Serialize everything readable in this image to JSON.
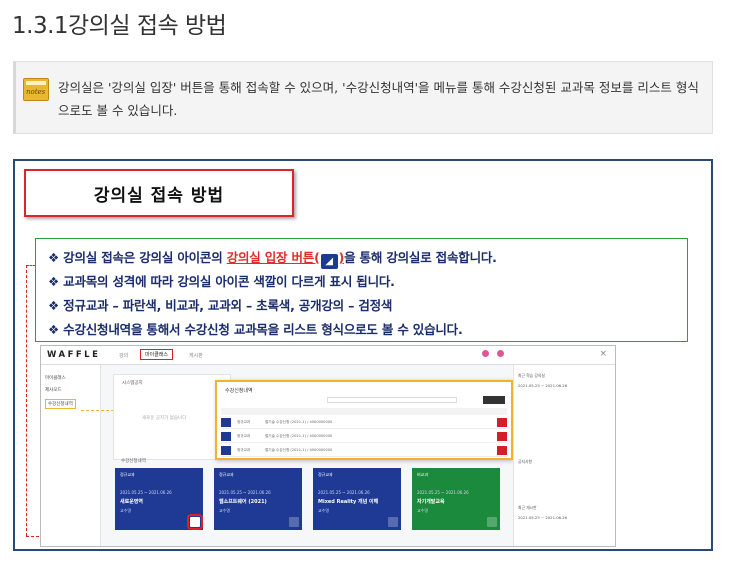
{
  "heading": "1.3.1강의실 접속 방법",
  "note": {
    "icon_label": "notes",
    "text": "강의실은 '강의실 입장' 버튼을 통해 접속할 수 있으며, '수강신청내역'을 메뉴를 통해 수강신청된 교과목 정보를 리스트 형식으로도 볼 수 있습니다."
  },
  "figure": {
    "title": "강의실 접속 방법",
    "bullets": [
      {
        "prefix": "❖ 강의실 접속은 강의실 아이콘의 ",
        "highlight": "강의실 입장 버튼(",
        "highlight_end": ")",
        "suffix": "을 통해 강의실로 접속합니다."
      },
      {
        "text": "❖ 교과목의 성격에 따라 강의실 아이콘 색깔이 다르게 표시 됩니다."
      },
      {
        "text": "❖ 정규교과 – 파란색, 비교과, 교과외 – 초록색, 공개강의 – 검정색"
      },
      {
        "text": "❖ 수강신청내역을 통해서 수강신청 교과목을 리스트 형식으로도 볼 수 있습니다."
      }
    ],
    "enter_glyph": "◢"
  },
  "screenshot": {
    "logo": "WAFFLE",
    "tabs": [
      "강의",
      "마이클래스",
      "게시판"
    ],
    "close": "×",
    "sidebar": [
      "마이클래스",
      "제사모드",
      "수강신청내역"
    ],
    "panel_title": "시스템공지",
    "panel_empty": "새로운 공지가 없습니다",
    "courses_title": "수강신청내역",
    "overlay_title": "수강신청내역",
    "overlay_rows": [
      {
        "name": "정규교과",
        "detail": "철기술 수강신청 (2021-1) / 4000000000"
      },
      {
        "name": "정규교과",
        "detail": "철기술 수강신청 (2021-1) / 4000000000"
      },
      {
        "name": "정규교과",
        "detail": "철기술 수강신청 (2021-1) / 4000000000"
      }
    ],
    "cards": [
      {
        "tag": "정규교과",
        "sub": "2021.05.25 ~ 2021.06.26",
        "name": "새로운영역",
        "prof": "교수명",
        "color": "blue"
      },
      {
        "tag": "정규교과",
        "sub": "2021.05.25 ~ 2021.06.26",
        "name": "웹소프트웨어 (2021)",
        "prof": "교수명",
        "color": "blue"
      },
      {
        "tag": "정규교과",
        "sub": "2021.05.25 ~ 2021.06.26",
        "name": "Mixed Reality 개념 이해",
        "prof": "교수명",
        "color": "blue"
      },
      {
        "tag": "비교과",
        "sub": "2021.05.25 ~ 2021.06.26",
        "name": "자기개발교육",
        "prof": "교수명",
        "color": "green"
      }
    ],
    "right_items": [
      "최근 학습 강의실",
      "2021.05.25 ~ 2021.06.26",
      "공지사항",
      "최근 게시판",
      "2021.05.25 ~ 2021.06.26"
    ]
  },
  "colors": {
    "accent_red": "#e42b2b",
    "bullet_navy": "#1a2c6b",
    "frame_blue": "#2b4a73",
    "regular_blue": "#1f3a94",
    "nonregular_green": "#1c8a3d",
    "highlight_yellow": "#f0b42c"
  }
}
